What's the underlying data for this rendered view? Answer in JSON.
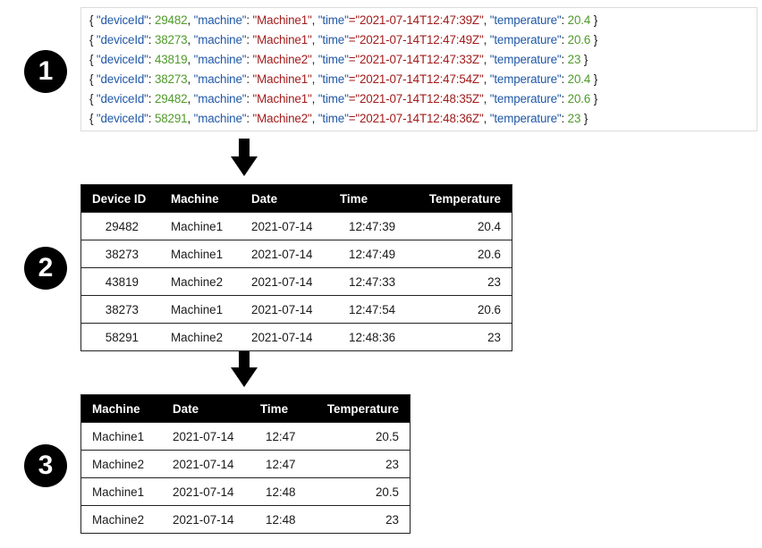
{
  "badges": [
    "1",
    "2",
    "3"
  ],
  "json_lines": [
    {
      "deviceId": "29482",
      "machine": "Machine1",
      "time": "2021-07-14T12:47:39Z",
      "temperature": "20.4"
    },
    {
      "deviceId": "38273",
      "machine": "Machine1",
      "time": "2021-07-14T12:47:49Z",
      "temperature": "20.6"
    },
    {
      "deviceId": "43819",
      "machine": "Machine2",
      "time": "2021-07-14T12:47:33Z",
      "temperature": "23"
    },
    {
      "deviceId": "38273",
      "machine": "Machine1",
      "time": "2021-07-14T12:47:54Z",
      "temperature": "20.4"
    },
    {
      "deviceId": "29482",
      "machine": "Machine1",
      "time": "2021-07-14T12:48:35Z",
      "temperature": "20.6"
    },
    {
      "deviceId": "58291",
      "machine": "Machine2",
      "time": "2021-07-14T12:48:36Z",
      "temperature": "23"
    }
  ],
  "json_keys": {
    "deviceId": "\"deviceId\"",
    "machine": "\"machine\"",
    "time": "\"time\"",
    "temperature": "\"temperature\""
  },
  "table2": {
    "headers": [
      "Device ID",
      "Machine",
      "Date",
      "Time",
      "Temperature"
    ],
    "rows": [
      [
        "29482",
        "Machine1",
        "2021-07-14",
        "12:47:39",
        "20.4"
      ],
      [
        "38273",
        "Machine1",
        "2021-07-14",
        "12:47:49",
        "20.6"
      ],
      [
        "43819",
        "Machine2",
        "2021-07-14",
        "12:47:33",
        "23"
      ],
      [
        "38273",
        "Machine1",
        "2021-07-14",
        "12:47:54",
        "20.6"
      ],
      [
        "58291",
        "Machine2",
        "2021-07-14",
        "12:48:36",
        "23"
      ]
    ]
  },
  "table3": {
    "headers": [
      "Machine",
      "Date",
      "Time",
      "Temperature"
    ],
    "rows": [
      [
        "Machine1",
        "2021-07-14",
        "12:47",
        "20.5"
      ],
      [
        "Machine2",
        "2021-07-14",
        "12:47",
        "23"
      ],
      [
        "Machine1",
        "2021-07-14",
        "12:48",
        "20.5"
      ],
      [
        "Machine2",
        "2021-07-14",
        "12:48",
        "23"
      ]
    ]
  },
  "colors": {
    "key": "#1f57a6",
    "string": "#a11b1b",
    "number": "#4f9a2a",
    "header_bg": "#000000"
  },
  "icons": {
    "arrow": "down-arrow-icon"
  }
}
